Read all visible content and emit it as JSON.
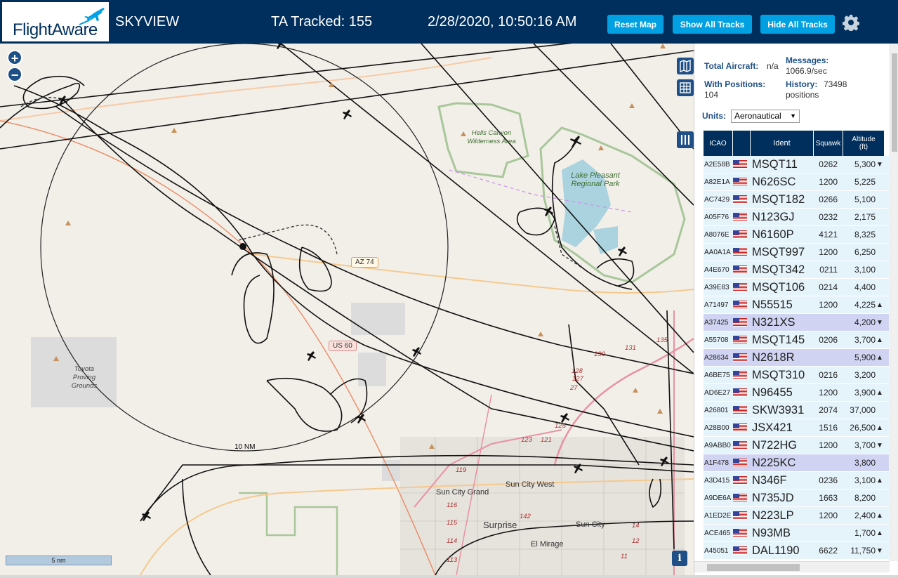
{
  "header": {
    "logo": "FlightAware",
    "site_title": "SKYVIEW",
    "ta_tracked": "TA Tracked: 155",
    "clock": "2/28/2020, 10:50:16 AM",
    "buttons": {
      "reset": "Reset Map",
      "show_all": "Show All Tracks",
      "hide_all": "Hide All Tracks"
    },
    "settings_icon": "gear-icon"
  },
  "map": {
    "zoom_in": "+",
    "zoom_out": "−",
    "scale_label": "5 nm",
    "range_ring_label": "10 NM",
    "info_button": "i",
    "labels": {
      "hells_canyon": "Hells Canyon Wilderness Area",
      "lake_pleasant": "Lake Pleasant Regional Park",
      "toyota": "Toyota Proving Grounds",
      "sun_city_grand": "Sun City Grand",
      "sun_city_west": "Sun City West",
      "surprise": "Surprise",
      "sun_city": "Sun City",
      "el_mirage": "El Mirage",
      "az74": "AZ 74",
      "us60": "US 60"
    },
    "road_numbers": [
      "135",
      "131",
      "130",
      "128",
      "127",
      "27",
      "125",
      "123",
      "121",
      "119",
      "116",
      "115",
      "114",
      "113",
      "142",
      "14",
      "12",
      "11"
    ]
  },
  "sidebar": {
    "total_aircraft_label": "Total Aircraft:",
    "total_aircraft_value": "n/a",
    "with_positions_label": "With Positions:",
    "with_positions_value": "104",
    "messages_label": "Messages:",
    "messages_value": "1066.9/sec",
    "history_label": "History:",
    "history_value": "73498",
    "history_unit": "positions",
    "units_label": "Units:",
    "units_value": "Aeronautical",
    "columns": {
      "icao": "ICAO",
      "ident": "Ident",
      "squawk": "Squawk",
      "altitude": "Altitude",
      "altitude_unit": "(ft)"
    },
    "rows": [
      {
        "icao": "A2E58B",
        "ident": "MSQT11",
        "squawk": "0262",
        "altitude": "5,300",
        "trend": "▼",
        "alt": false
      },
      {
        "icao": "A82E1A",
        "ident": "N626SC",
        "squawk": "1200",
        "altitude": "5,225",
        "trend": "",
        "alt": false
      },
      {
        "icao": "AC7429",
        "ident": "MSQT182",
        "squawk": "0266",
        "altitude": "5,100",
        "trend": "",
        "alt": false
      },
      {
        "icao": "A05F76",
        "ident": "N123GJ",
        "squawk": "0232",
        "altitude": "2,175",
        "trend": "",
        "alt": false
      },
      {
        "icao": "A8076E",
        "ident": "N6160P",
        "squawk": "4121",
        "altitude": "8,325",
        "trend": "",
        "alt": false
      },
      {
        "icao": "AA0A1A",
        "ident": "MSQT997",
        "squawk": "1200",
        "altitude": "6,250",
        "trend": "",
        "alt": false
      },
      {
        "icao": "A4E670",
        "ident": "MSQT342",
        "squawk": "0211",
        "altitude": "3,100",
        "trend": "",
        "alt": false
      },
      {
        "icao": "A39E83",
        "ident": "MSQT106",
        "squawk": "0214",
        "altitude": "4,400",
        "trend": "",
        "alt": false
      },
      {
        "icao": "A71497",
        "ident": "N55515",
        "squawk": "1200",
        "altitude": "4,225",
        "trend": "▲",
        "alt": false
      },
      {
        "icao": "A37425",
        "ident": "N321XS",
        "squawk": "",
        "altitude": "4,200",
        "trend": "▼",
        "alt": true
      },
      {
        "icao": "A55708",
        "ident": "MSQT145",
        "squawk": "0206",
        "altitude": "3,700",
        "trend": "▲",
        "alt": false
      },
      {
        "icao": "A28634",
        "ident": "N2618R",
        "squawk": "",
        "altitude": "5,900",
        "trend": "▲",
        "alt": true
      },
      {
        "icao": "A6BE75",
        "ident": "MSQT310",
        "squawk": "0216",
        "altitude": "3,200",
        "trend": "",
        "alt": false
      },
      {
        "icao": "AD6E27",
        "ident": "N96455",
        "squawk": "1200",
        "altitude": "3,900",
        "trend": "▲",
        "alt": false
      },
      {
        "icao": "A26801",
        "ident": "SKW3931",
        "squawk": "2074",
        "altitude": "37,000",
        "trend": "",
        "alt": false
      },
      {
        "icao": "A28B00",
        "ident": "JSX421",
        "squawk": "1516",
        "altitude": "26,500",
        "trend": "▲",
        "alt": false
      },
      {
        "icao": "A9ABB0",
        "ident": "N722HG",
        "squawk": "1200",
        "altitude": "3,700",
        "trend": "▼",
        "alt": false
      },
      {
        "icao": "A1F478",
        "ident": "N225KC",
        "squawk": "",
        "altitude": "3,800",
        "trend": "",
        "alt": true
      },
      {
        "icao": "A3D415",
        "ident": "N346F",
        "squawk": "0236",
        "altitude": "3,100",
        "trend": "▲",
        "alt": false
      },
      {
        "icao": "A9DE6A",
        "ident": "N735JD",
        "squawk": "1663",
        "altitude": "8,200",
        "trend": "",
        "alt": false
      },
      {
        "icao": "A1ED2E",
        "ident": "N223LP",
        "squawk": "1200",
        "altitude": "2,400",
        "trend": "▲",
        "alt": false
      },
      {
        "icao": "ACE465",
        "ident": "N93MB",
        "squawk": "",
        "altitude": "1,700",
        "trend": "▲",
        "alt": false
      },
      {
        "icao": "A45051",
        "ident": "DAL1190",
        "squawk": "6622",
        "altitude": "11,750",
        "trend": "▼",
        "alt": false
      }
    ]
  }
}
